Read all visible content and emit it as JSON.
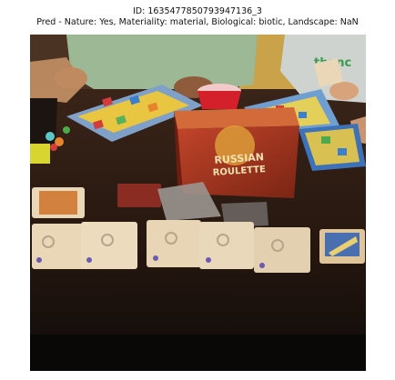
{
  "caption": {
    "line1": "ID: 1635477850793947136_3",
    "line2": "Pred - Nature: Yes, Materiality: material, Biological: biotic, Landscape: NaN"
  },
  "photo": {
    "box_line1": "RUSSIAN",
    "box_line2": "ROULETTE",
    "shirt_text": "thanc",
    "colors": {
      "table": "#2a1a12",
      "wall": "#c9a24a",
      "shirt_left": "#9db894",
      "shirt_right": "#cfd3cf",
      "box_red": "#b0321f",
      "cup": "#d3202a",
      "card": "#e9d7b8"
    }
  }
}
